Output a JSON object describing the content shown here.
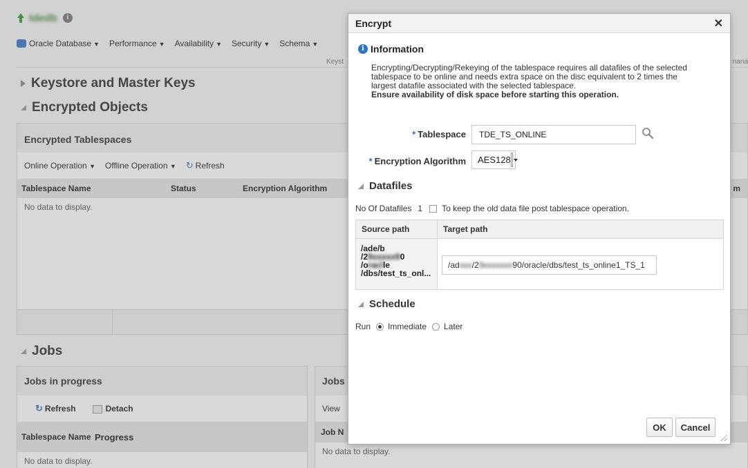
{
  "background": {
    "db_name": "tdedb",
    "menu": [
      "Oracle Database",
      "Performance",
      "Availability",
      "Security",
      "Schema"
    ],
    "keystore_tab": "Keyst",
    "keystore_tab_right": "nana",
    "keystore_section": "Keystore and Master Keys",
    "encrypted_section": "Encrypted Objects",
    "encrypted_tablespaces": {
      "title": "Encrypted Tablespaces",
      "toolbar": [
        "Online Operation",
        "Offline Operation",
        "Refresh"
      ],
      "columns": [
        "Tablespace Name",
        "Status",
        "Encryption Algorithm"
      ],
      "partial_column": "m",
      "empty": "No data to display."
    },
    "jobs_section": "Jobs",
    "jobs_in_progress": {
      "title": "Jobs in progress",
      "toolbar": [
        "Refresh",
        "Detach"
      ],
      "columns": [
        "Tablespace Name",
        "Progress"
      ],
      "empty": "No data to display."
    },
    "jobs_right": {
      "title": "Jobs",
      "toolbar": "View",
      "column": "Job N",
      "empty": "No data to display."
    }
  },
  "dialog": {
    "title": "Encrypt",
    "info_title": "Information",
    "info_text": "Encrypting/Decrypting/Rekeying of the tablespace requires all datafiles of the selected tablespace to be online and needs extra space on the disc equivalent to 2 times the largest datafile associated with the selected tablespace.",
    "info_bold": "Ensure availability of disk space before starting this operation.",
    "tablespace_label": "Tablespace",
    "tablespace_value": "TDE_TS_ONLINE",
    "algorithm_label": "Encryption Algorithm",
    "algorithm_value": "AES128",
    "datafiles_section": "Datafiles",
    "num_datafiles_label": "No Of Datafiles",
    "num_datafiles_value": "1",
    "keep_old_label": "To keep the old data file post tablespace operation.",
    "source_header": "Source path",
    "target_header": "Target path",
    "source_lines": [
      "/ade/b",
      "/2",
      "0",
      "/o",
      "le",
      "/dbs/test_ts_onl..."
    ],
    "target_prefix": "/ad",
    "target_mid": "/2",
    "target_suffix": "90/oracle/dbs/test_ts_online1_TS_1",
    "schedule_section": "Schedule",
    "run_label": "Run",
    "immediate_label": "Immediate",
    "later_label": "Later",
    "ok_label": "OK",
    "cancel_label": "Cancel"
  }
}
